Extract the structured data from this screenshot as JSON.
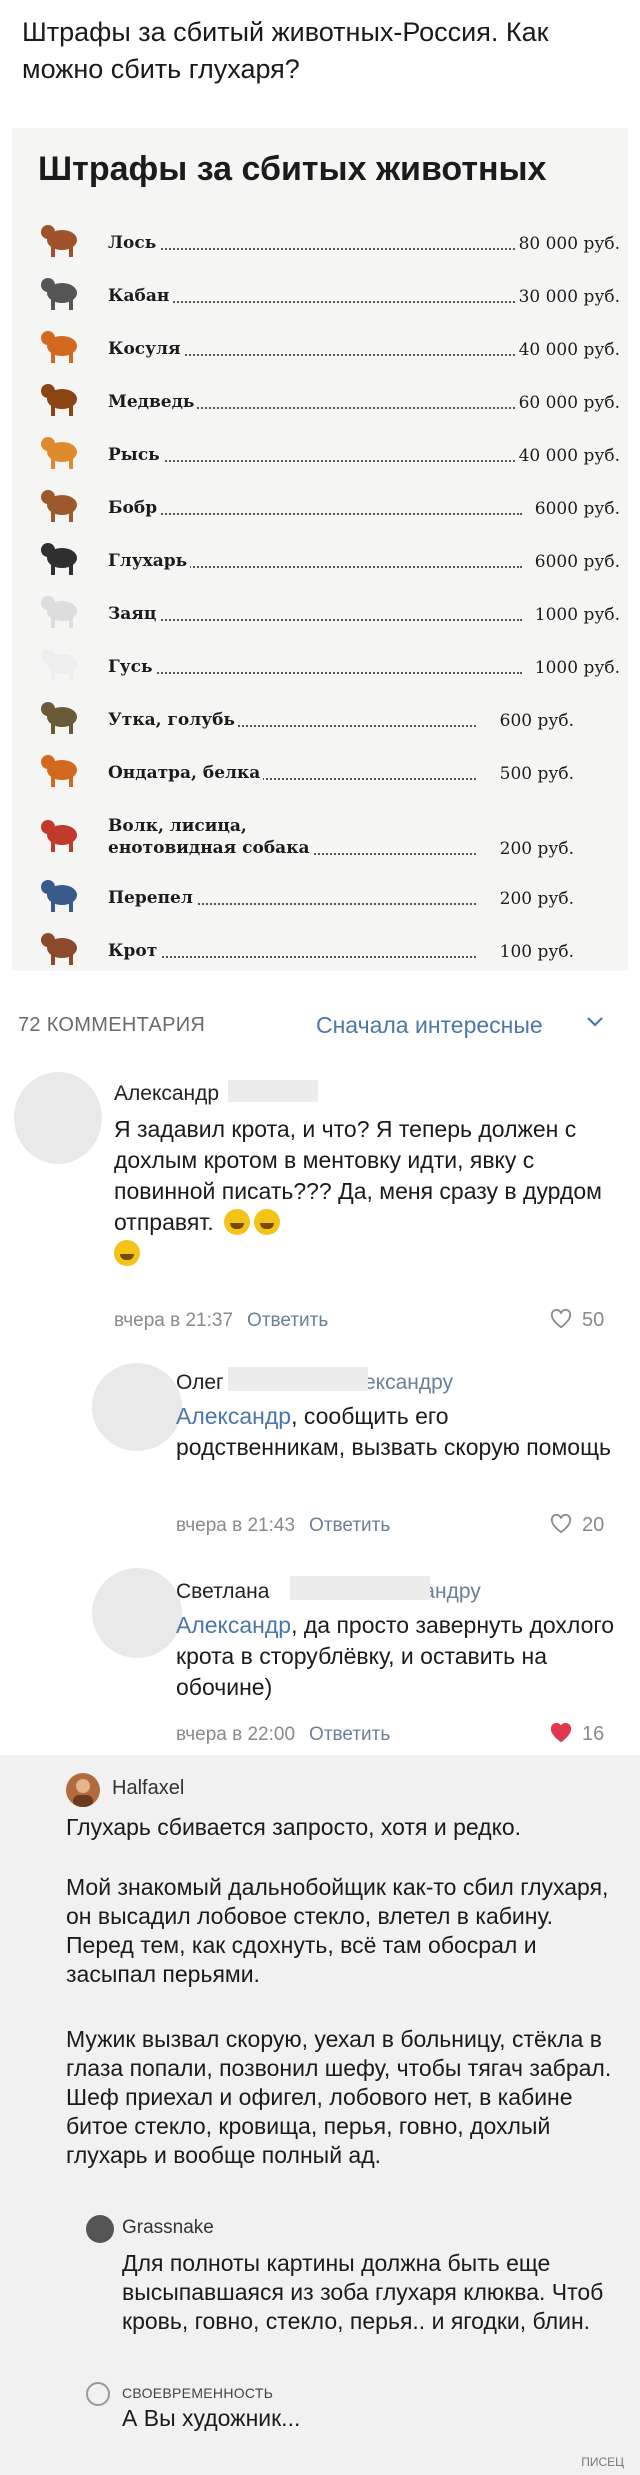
{
  "post": {
    "title": "Штрафы за сбитый животных-Россия. Как можно сбить глухаря?"
  },
  "fines": {
    "title": "Штрафы за сбитых животных",
    "rows": [
      {
        "name": "Лось",
        "price": "80 000 руб.",
        "icon": "moose-icon",
        "color": "#a0522d"
      },
      {
        "name": "Кабан",
        "price": "30 000 руб.",
        "icon": "boar-icon",
        "color": "#555555"
      },
      {
        "name": "Косуля",
        "price": "40 000 руб.",
        "icon": "roe-deer-icon",
        "color": "#d2691e"
      },
      {
        "name": "Медведь",
        "price": "60 000 руб.",
        "icon": "bear-icon",
        "color": "#8b4513"
      },
      {
        "name": "Рысь",
        "price": "40 000 руб.",
        "icon": "lynx-icon",
        "color": "#e08a2e"
      },
      {
        "name": "Бобр",
        "price": "6000 руб.",
        "icon": "beaver-icon",
        "color": "#9c5a2c"
      },
      {
        "name": "Глухарь",
        "price": "6000 руб.",
        "icon": "capercaillie-icon",
        "color": "#2f2f2f"
      },
      {
        "name": "Заяц",
        "price": "1000 руб.",
        "icon": "hare-icon",
        "color": "#dddddd"
      },
      {
        "name": "Гусь",
        "price": "1000 руб.",
        "icon": "goose-icon",
        "color": "#eeeeee"
      },
      {
        "name": "Утка, голубь",
        "price": "600 руб.",
        "icon": "duck-icon",
        "color": "#6b5a3a"
      },
      {
        "name": "Ондатра, белка",
        "price": "500 руб.",
        "icon": "squirrel-icon",
        "color": "#d2691e"
      },
      {
        "name": "Волк, лисица,\nенотовидная собака",
        "price": "200 руб.",
        "icon": "fox-icon",
        "color": "#c0392b"
      },
      {
        "name": "Перепел",
        "price": "200 руб.",
        "icon": "quail-icon",
        "color": "#3a5a8a"
      },
      {
        "name": "Крот",
        "price": "100 руб.",
        "icon": "mole-icon",
        "color": "#8b4a2b"
      }
    ]
  },
  "comments_header": {
    "count": "72 КОММЕНТАРИЯ",
    "sort": "Сначала интересные"
  },
  "comments": [
    {
      "author": "Александр",
      "reply_to": "",
      "text": "Я задавил крота, и что? Я теперь должен с дохлым кротом в ментовку идти, явку с повинной писать??? Да, меня сразу в дурдом отправят.",
      "time": "вчера в 21:37",
      "reply": "Ответить",
      "likes": "50",
      "liked": false
    },
    {
      "author": "Олег",
      "reply_to": "Александру",
      "text_prefix": "Александр",
      "text": ", сообщить его родственникам, вызвать скорую помощь",
      "time": "вчера в 21:43",
      "reply": "Ответить",
      "likes": "20",
      "liked": false
    },
    {
      "author": "Светлана",
      "reply_to": "Александру",
      "text_prefix": "Александр",
      "text": ", да просто завернуть дохлого крота в сторублёвку, и оставить на обочине)",
      "time": "вчера в 22:00",
      "reply": "Ответить",
      "likes": "16",
      "liked": true
    }
  ],
  "thread": {
    "author": "Halfaxel",
    "p1": "Глухарь сбивается запросто, хотя и редко.",
    "p2": "Мой знакомый дальнобойщик как-то сбил глухаря, он высадил лобовое стекло, влетел в кабину. Перед тем, как сдохнуть, всё там обосрал и засыпал перьями.",
    "p3": "Мужик вызвал скорую, уехал в больницу, стёкла в глаза попали, позвонил шефу, чтобы тягач забрал. Шеф приехал и офигел, лобового нет, в кабине битое стекло, кровища, перья, говно, дохлый глухарь и вообще полный ад.",
    "reply1_author": "Grassnake",
    "reply1_text": "Для полноты картины должна быть еще высыпавшаяся из зоба глухаря клюква. Чтоб кровь, говно, стекло, перья.. и ягодки, блин.",
    "reply2_author": "СВОЕВРЕМЕННОСТЬ",
    "reply2_text": "А Вы художник..."
  },
  "watermark": "ПИСЕЦ",
  "colors": {
    "link": "#4b77a9",
    "heart": "#e0394d"
  }
}
